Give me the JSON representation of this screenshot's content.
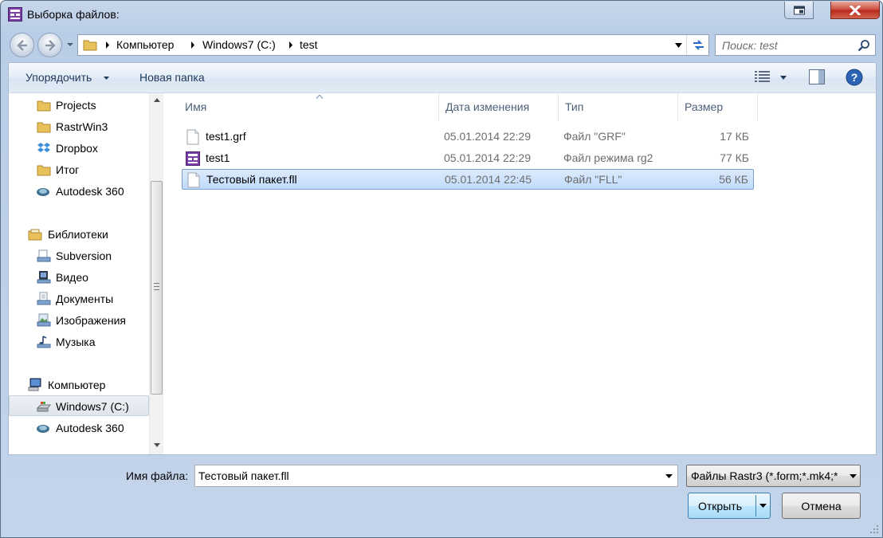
{
  "window": {
    "title": "Выборка файлов:",
    "colors": {
      "frame": "#c3d4ea",
      "close": "#c8483a",
      "selection": "#c1dbfc",
      "accent": "#3c7fb1"
    }
  },
  "address": {
    "crumbs": [
      "Компьютер",
      "Windows7 (C:)",
      "test"
    ]
  },
  "search": {
    "placeholder": "Поиск: test"
  },
  "toolbar": {
    "organize": "Упорядочить",
    "new_folder": "Новая папка"
  },
  "nav": {
    "items": [
      {
        "label": "Projects",
        "icon": "folder-icon"
      },
      {
        "label": "RastrWin3",
        "icon": "folder-icon"
      },
      {
        "label": "Dropbox",
        "icon": "dropbox-icon"
      },
      {
        "label": "Итог",
        "icon": "folder-icon"
      },
      {
        "label": "Autodesk 360",
        "icon": "cloud-drive-icon"
      },
      {
        "label": "Библиотеки",
        "icon": "libraries-icon"
      },
      {
        "label": "Subversion",
        "icon": "library-icon"
      },
      {
        "label": "Видео",
        "icon": "video-library-icon"
      },
      {
        "label": "Документы",
        "icon": "documents-library-icon"
      },
      {
        "label": "Изображения",
        "icon": "pictures-library-icon"
      },
      {
        "label": "Музыка",
        "icon": "music-library-icon"
      },
      {
        "label": "Компьютер",
        "icon": "computer-icon"
      },
      {
        "label": "Windows7 (C:)",
        "icon": "drive-icon"
      },
      {
        "label": "Autodesk 360",
        "icon": "cloud-drive-icon"
      }
    ]
  },
  "columns": {
    "name": "Имя",
    "date": "Дата изменения",
    "type": "Тип",
    "size": "Размер"
  },
  "files": [
    {
      "name": "test1.grf",
      "date": "05.01.2014 22:29",
      "type": "Файл \"GRF\"",
      "size": "17 КБ",
      "icon": "generic-file-icon"
    },
    {
      "name": "test1",
      "date": "05.01.2014 22:29",
      "type": "Файл режима rg2",
      "size": "77 КБ",
      "icon": "rastr-file-icon"
    },
    {
      "name": "Тестовый пакет.fll",
      "date": "05.01.2014 22:45",
      "type": "Файл \"FLL\"",
      "size": "56 КБ",
      "icon": "generic-file-icon"
    }
  ],
  "footer": {
    "filename_label": "Имя файла:",
    "filename_value": "Тестовый пакет.fll",
    "filter_value": "Файлы Rastr3 (*.form;*.mk4;*",
    "open_label": "Открыть",
    "cancel_label": "Отмена"
  }
}
